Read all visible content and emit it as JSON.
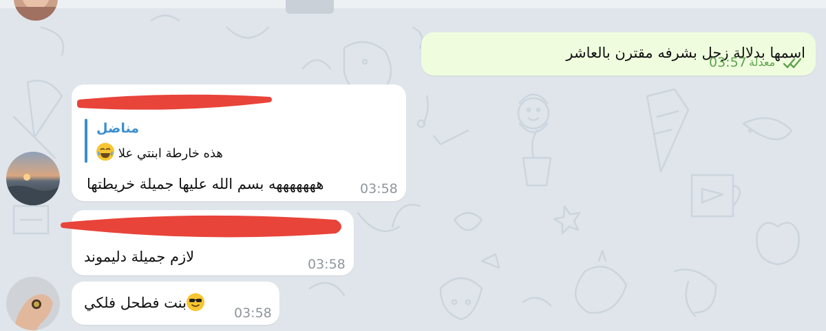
{
  "messages": [
    {
      "id": "outgoing-1",
      "direction": "outgoing",
      "text": "اسمها بدلالة زحل بشرفه مقترن بالعاشر",
      "edited_label": "معدلة",
      "time": "03:57",
      "status_icon": "double-check-icon"
    },
    {
      "id": "incoming-1",
      "direction": "incoming",
      "sender_redacted": true,
      "reply": {
        "author": "مناضل",
        "text": "هذه خارطة ابنتي علا",
        "emoji": "face-with-tears-of-joy"
      },
      "text": "هههههههه بسم الله عليها جميلة خريطتها",
      "time": "03:58"
    },
    {
      "id": "incoming-2",
      "direction": "incoming",
      "sender_redacted": true,
      "text": "لازم جميلة دليموند",
      "time": "03:58"
    },
    {
      "id": "incoming-3",
      "direction": "incoming",
      "text": "بنت فطحل فلكي",
      "emoji": "smiling-face-with-sunglasses",
      "time": "03:58"
    }
  ],
  "colors": {
    "background": "#dfe5eb",
    "outgoing_bubble": "#effdde",
    "incoming_bubble": "#ffffff",
    "accent": "#3a8fd0",
    "check_green": "#5fa24e",
    "redaction": "#e8443a"
  }
}
